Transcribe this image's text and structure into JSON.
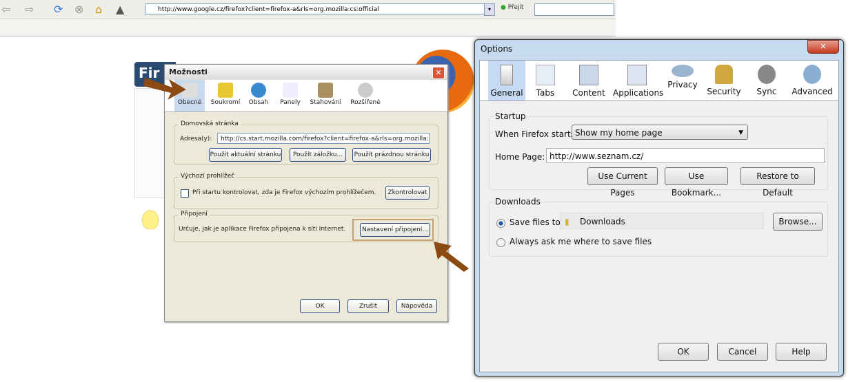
{
  "browser": {
    "url": "http://www.google.cz/firefox?client=firefox-a&rls=org.mozilla:cs:official",
    "go_label": "Přejít",
    "page_brand": "Fir"
  },
  "xp_dialog": {
    "title": "Možnosti",
    "tabs": [
      "Obecné",
      "Soukromí",
      "Obsah",
      "Panely",
      "Stahování",
      "Rozšířené"
    ],
    "home": {
      "legend": "Domovská stránka",
      "address_label": "Adresa(y):",
      "address_value": "http://cs.start.mozilla.com/firefox?client=firefox-a&rls=org.mozilla:cs:o",
      "buttons": [
        "Použít aktuální stránku",
        "Použít záložku...",
        "Použít prázdnou stránku"
      ]
    },
    "default_browser": {
      "legend": "Výchozí prohlížeč",
      "checkbox_label": "Při startu kontrolovat, zda je Firefox výchozím prohlížečem.",
      "check_button": "Zkontrolovat"
    },
    "connection": {
      "legend": "Připojení",
      "text": "Určuje, jak je aplikace Firefox připojena k síti Internet.",
      "button": "Nastavení připojení..."
    },
    "footer": [
      "OK",
      "Zrušit",
      "Nápověda"
    ]
  },
  "options": {
    "title": "Options",
    "tabs": [
      "General",
      "Tabs",
      "Content",
      "Applications",
      "Privacy",
      "Security",
      "Sync",
      "Advanced"
    ],
    "startup": {
      "legend": "Startup",
      "when_label": "When Firefox starts:",
      "when_value": "Show my home page",
      "home_label": "Home Page:",
      "home_value": "http://www.seznam.cz/",
      "buttons": [
        "Use Current Pages",
        "Use Bookmark...",
        "Restore to Default"
      ]
    },
    "downloads": {
      "legend": "Downloads",
      "save_label": "Save files to",
      "folder": "Downloads",
      "browse": "Browse...",
      "ask_label": "Always ask me where to save files"
    },
    "footer": [
      "OK",
      "Cancel",
      "Help"
    ]
  },
  "colors": {
    "arrow": "#8b4a12",
    "highlight": "#c8a070"
  }
}
